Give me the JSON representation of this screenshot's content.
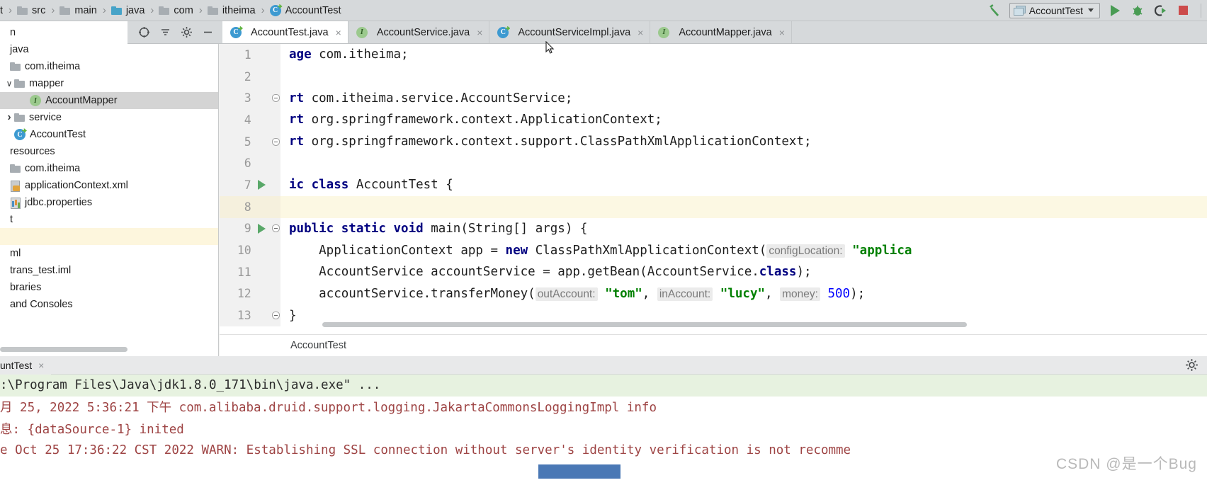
{
  "navbar": {
    "breadcrumbs": [
      {
        "label": "t",
        "icon": "partial-text"
      },
      {
        "label": "src",
        "icon": "folder-icon"
      },
      {
        "label": "main",
        "icon": "folder-icon"
      },
      {
        "label": "java",
        "icon": "folder-source-icon"
      },
      {
        "label": "com",
        "icon": "folder-icon"
      },
      {
        "label": "itheima",
        "icon": "folder-icon"
      },
      {
        "label": "AccountTest",
        "icon": "java-class-icon"
      }
    ],
    "separator": "›",
    "build_icon": "hammer-icon",
    "run_config": {
      "label": "AccountTest",
      "icon": "run-config-icon",
      "caret": "chevron-down-icon"
    },
    "run_button": "run-icon",
    "debug_button": "debug-icon",
    "run_coverage_button": "run-with-coverage-icon",
    "stop_button": "stop-icon"
  },
  "sidebar": {
    "tools": [
      "locate-icon",
      "collapse-all-icon",
      "settings-icon",
      "hide-icon"
    ],
    "tree": [
      {
        "label": "n",
        "indent": 0,
        "icon": "none",
        "arrow": "none",
        "state": "normal"
      },
      {
        "label": "java",
        "indent": 0,
        "icon": "none",
        "arrow": "none",
        "state": "normal"
      },
      {
        "label": "com.itheima",
        "indent": 0,
        "icon": "folder-icon",
        "arrow": "none",
        "state": "normal"
      },
      {
        "label": "mapper",
        "indent": 1,
        "icon": "folder-icon",
        "arrow": "down",
        "state": "normal"
      },
      {
        "label": "AccountMapper",
        "indent": 2,
        "icon": "interface-icon",
        "arrow": "none",
        "state": "selected"
      },
      {
        "label": "service",
        "indent": 1,
        "icon": "folder-icon",
        "arrow": "right",
        "state": "normal"
      },
      {
        "label": "AccountTest",
        "indent": 1,
        "icon": "java-class-icon",
        "arrow": "none",
        "state": "normal"
      },
      {
        "label": "resources",
        "indent": 0,
        "icon": "none",
        "arrow": "none",
        "state": "normal"
      },
      {
        "label": "com.itheima",
        "indent": 0,
        "icon": "folder-icon",
        "arrow": "none",
        "state": "normal"
      },
      {
        "label": "applicationContext.xml",
        "indent": 0,
        "icon": "xml-file-icon",
        "arrow": "none",
        "state": "normal"
      },
      {
        "label": "jdbc.properties",
        "indent": 0,
        "icon": "properties-icon",
        "arrow": "none",
        "state": "normal"
      },
      {
        "label": "t",
        "indent": 0,
        "icon": "none",
        "arrow": "none",
        "state": "normal"
      },
      {
        "label": "",
        "indent": 0,
        "icon": "none",
        "arrow": "none",
        "state": "highlight"
      },
      {
        "label": "ml",
        "indent": 0,
        "icon": "none",
        "arrow": "none",
        "state": "normal"
      },
      {
        "label": "trans_test.iml",
        "indent": 0,
        "icon": "none",
        "arrow": "none",
        "state": "normal"
      },
      {
        "label": "braries",
        "indent": 0,
        "icon": "none",
        "arrow": "none",
        "state": "normal"
      },
      {
        "label": "and Consoles",
        "indent": 0,
        "icon": "none",
        "arrow": "none",
        "state": "normal"
      }
    ]
  },
  "editor": {
    "tabs": [
      {
        "label": "AccountTest.java",
        "icon": "java-class-icon",
        "active": true,
        "close": "×"
      },
      {
        "label": "AccountService.java",
        "icon": "interface-icon",
        "active": false,
        "close": "×"
      },
      {
        "label": "AccountServiceImpl.java",
        "icon": "java-class-icon",
        "active": false,
        "close": "×"
      },
      {
        "label": "AccountMapper.java",
        "icon": "interface-icon",
        "active": false,
        "close": "×"
      }
    ],
    "breadcrumb_bottom": "AccountTest",
    "lines": [
      {
        "num": "1",
        "marker": "none",
        "fold": false,
        "caret": false,
        "tokens": [
          {
            "t": "age",
            "c": "kw"
          },
          {
            "t": " com.itheima;",
            "c": ""
          }
        ]
      },
      {
        "num": "2",
        "marker": "none",
        "fold": false,
        "caret": false,
        "tokens": []
      },
      {
        "num": "3",
        "marker": "none",
        "fold": true,
        "caret": false,
        "tokens": [
          {
            "t": "rt",
            "c": "kw"
          },
          {
            "t": " com.itheima.service.AccountService;",
            "c": ""
          }
        ]
      },
      {
        "num": "4",
        "marker": "none",
        "fold": false,
        "caret": false,
        "tokens": [
          {
            "t": "rt",
            "c": "kw"
          },
          {
            "t": " org.springframework.context.ApplicationContext;",
            "c": ""
          }
        ]
      },
      {
        "num": "5",
        "marker": "none",
        "fold": true,
        "caret": false,
        "tokens": [
          {
            "t": "rt",
            "c": "kw"
          },
          {
            "t": " org.springframework.context.support.ClassPathXmlApplicationContext;",
            "c": ""
          }
        ]
      },
      {
        "num": "6",
        "marker": "none",
        "fold": false,
        "caret": false,
        "tokens": []
      },
      {
        "num": "7",
        "marker": "run",
        "fold": false,
        "caret": false,
        "tokens": [
          {
            "t": "ic class",
            "c": "kw"
          },
          {
            "t": " AccountTest {",
            "c": ""
          }
        ]
      },
      {
        "num": "8",
        "marker": "none",
        "fold": false,
        "caret": true,
        "tokens": []
      },
      {
        "num": "9",
        "marker": "run",
        "fold": true,
        "caret": false,
        "tokens": [
          {
            "t": "public static void",
            "c": "kw"
          },
          {
            "t": " main(String[] args) {",
            "c": ""
          }
        ]
      },
      {
        "num": "10",
        "marker": "none",
        "fold": false,
        "caret": false,
        "tokens": [
          {
            "t": "    ApplicationContext app = ",
            "c": ""
          },
          {
            "t": "new",
            "c": "kw"
          },
          {
            "t": " ClassPathXmlApplicationContext(",
            "c": ""
          },
          {
            "t": "configLocation:",
            "c": "hint"
          },
          {
            "t": " \"applica",
            "c": "str"
          }
        ]
      },
      {
        "num": "11",
        "marker": "none",
        "fold": false,
        "caret": false,
        "tokens": [
          {
            "t": "    AccountService accountService = app.getBean(AccountService.",
            "c": ""
          },
          {
            "t": "class",
            "c": "kw"
          },
          {
            "t": ");",
            "c": ""
          }
        ]
      },
      {
        "num": "12",
        "marker": "none",
        "fold": false,
        "caret": false,
        "tokens": [
          {
            "t": "    accountService.transferMoney(",
            "c": ""
          },
          {
            "t": "outAccount:",
            "c": "hint"
          },
          {
            "t": " ",
            "c": ""
          },
          {
            "t": "\"tom\"",
            "c": "str"
          },
          {
            "t": ", ",
            "c": ""
          },
          {
            "t": "inAccount:",
            "c": "hint"
          },
          {
            "t": " ",
            "c": ""
          },
          {
            "t": "\"lucy\"",
            "c": "str"
          },
          {
            "t": ", ",
            "c": ""
          },
          {
            "t": "money:",
            "c": "hint"
          },
          {
            "t": " ",
            "c": ""
          },
          {
            "t": "500",
            "c": "num"
          },
          {
            "t": ");",
            "c": ""
          }
        ]
      },
      {
        "num": "13",
        "marker": "none",
        "fold": true,
        "caret": false,
        "tokens": [
          {
            "t": "}",
            "c": ""
          }
        ]
      }
    ]
  },
  "run_window": {
    "tab_label": "untTest",
    "tab_close": "×",
    "settings_icon": "gear-icon",
    "console_lines": [
      {
        "text": ":\\Program Files\\Java\\jdk1.8.0_171\\bin\\java.exe\" ...",
        "kind": "stdout"
      },
      {
        "text": "月 25, 2022 5:36:21 下午 com.alibaba.druid.support.logging.JakartaCommonsLoggingImpl info",
        "kind": "stderr"
      },
      {
        "text": "息: {dataSource-1} inited",
        "kind": "stderr"
      },
      {
        "text": "e Oct 25 17:36:22 CST 2022 WARN: Establishing SSL connection without server's identity verification is not recomme",
        "kind": "stderr"
      },
      {
        "text": "",
        "kind": "stderr"
      }
    ]
  },
  "watermark": "CSDN @是一个Bug",
  "colors": {
    "accent_green": "#499c54",
    "stop_red": "#cc4b4b",
    "keyword_blue": "#000080",
    "string_green": "#008000",
    "number_blue": "#0000ff",
    "console_red": "#9e4444",
    "caret_line": "#fcf8e3"
  }
}
